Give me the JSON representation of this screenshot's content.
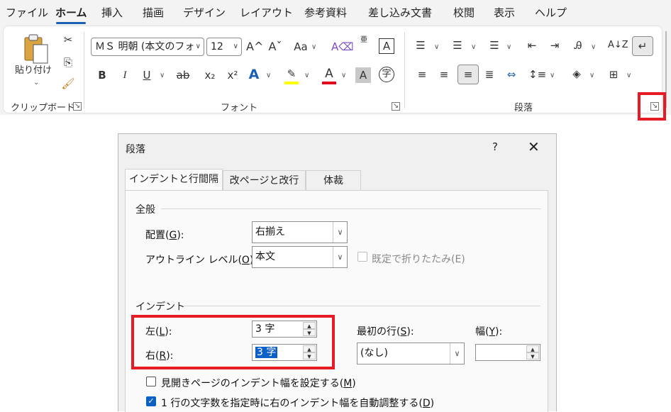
{
  "menubar": {
    "items": [
      "ファイル",
      "ホーム",
      "挿入",
      "描画",
      "デザイン",
      "レイアウト",
      "参考資料",
      "差し込み文書",
      "校閲",
      "表示",
      "ヘルプ"
    ],
    "active": "ホーム"
  },
  "ribbon": {
    "clipboard": {
      "paste_label": "貼り付け",
      "paste_arrow": "⌄",
      "group_label": "クリップボード"
    },
    "font": {
      "font_name": "ＭＳ 明朝 (本文のフォ",
      "font_size": "12",
      "grow": "A^",
      "shrink": "Aˇ",
      "case": "Aa",
      "bold": "B",
      "italic": "I",
      "underline": "U",
      "strike": "ab",
      "subscript": "x₂",
      "superscript": "x²",
      "phonetic": "亜",
      "group_label": "フォント"
    },
    "paragraph": {
      "group_label": "段落"
    },
    "colors": {
      "highlight": "#ffff00",
      "font_color": "#e0001b",
      "accent": "#1a5fb4",
      "red_box": "#e61b23"
    }
  },
  "dialog": {
    "title": "段落",
    "help": "?",
    "close": "✕",
    "tabs": [
      "インデントと行間隔",
      "改ページと改行",
      "体裁"
    ],
    "general": {
      "section": "全般",
      "alignment_label": "配置(",
      "alignment_key": "G",
      "alignment_end": "):",
      "alignment_value": "右揃え",
      "outline_label": "アウトライン レベル(",
      "outline_key": "O",
      "outline_end": "):",
      "outline_value": "本文",
      "collapsed_label": "既定で折りたたみ(E)"
    },
    "indent": {
      "section": "インデント",
      "left_label": "左(",
      "left_key": "L",
      "left_end": "):",
      "left_value": "3 字",
      "right_label": "右(",
      "right_key": "R",
      "right_end": "):",
      "right_value": "3 字",
      "first_line_label": "最初の行(",
      "first_line_key": "S",
      "first_line_end": "):",
      "first_line_value": "(なし)",
      "width_label": "幅(",
      "width_key": "Y",
      "width_end": "):",
      "width_value": "",
      "mirror_label": "見開きページのインデント幅を設定する(",
      "mirror_key": "M",
      "mirror_end": ")",
      "auto_adjust_label": "1 行の文字数を指定時に右のインデント幅を自動調整する(",
      "auto_adjust_key": "D",
      "auto_adjust_end": ")"
    }
  }
}
